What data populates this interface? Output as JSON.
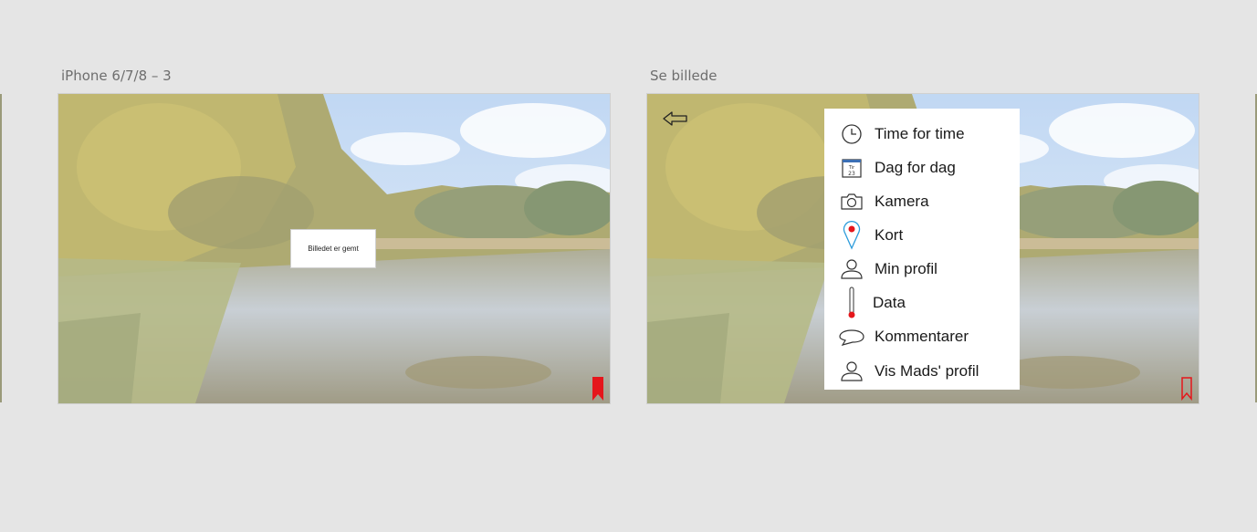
{
  "artboards": [
    {
      "title": "iPhone 6/7/8 – 3",
      "toast": "Billedet er gemt"
    },
    {
      "title": "Se billede"
    }
  ],
  "menu": {
    "items": [
      {
        "label": "Time for time",
        "icon": "clock-icon"
      },
      {
        "label": "Dag for dag",
        "icon": "calendar-icon",
        "calendar_text": "Tir",
        "calendar_day": "23"
      },
      {
        "label": "Kamera",
        "icon": "camera-icon"
      },
      {
        "label": "Kort",
        "icon": "map-pin-icon"
      },
      {
        "label": "Min profil",
        "icon": "user-icon"
      },
      {
        "label": "Data",
        "icon": "thermometer-icon"
      },
      {
        "label": "Kommentarer",
        "icon": "speech-bubble-icon"
      },
      {
        "label": "Vis Mads' profil",
        "icon": "user-icon"
      }
    ]
  },
  "colors": {
    "canvas": "#e5e5e5",
    "bookmark": "#e5161b",
    "pin": "#2d9cdb"
  }
}
